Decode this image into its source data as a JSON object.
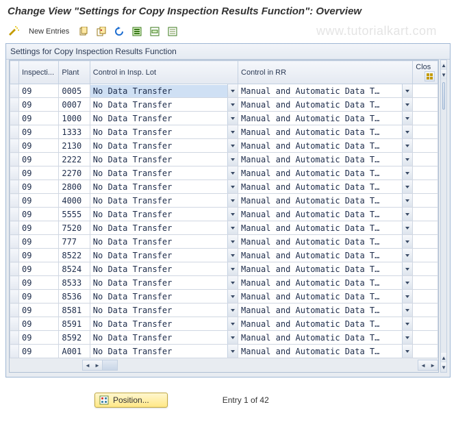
{
  "title": "Change View \"Settings for Copy Inspection Results Function\": Overview",
  "watermark": "www.tutorialkart.com",
  "toolbar": {
    "new_entries_label": "New Entries",
    "icons": {
      "wand": "wand-icon",
      "copy": "copy-icon",
      "copyall": "copy-all-icon",
      "undo": "undo-icon",
      "sel1": "select-all-icon",
      "sel2": "select-block-icon",
      "sel3": "deselect-all-icon"
    }
  },
  "panel": {
    "title": "Settings for Copy Inspection Results Function"
  },
  "columns": {
    "inspecti": "Inspecti...",
    "plant": "Plant",
    "cil": "Control in Insp. Lot",
    "crr": "Control in RR",
    "close": "Clos"
  },
  "rows": [
    {
      "insp": "09",
      "plant": "0005",
      "cil": "No Data Transfer",
      "crr": "Manual and Automatic Data T…",
      "close": ""
    },
    {
      "insp": "09",
      "plant": "0007",
      "cil": "No Data Transfer",
      "crr": "Manual and Automatic Data T…",
      "close": ""
    },
    {
      "insp": "09",
      "plant": "1000",
      "cil": "No Data Transfer",
      "crr": "Manual and Automatic Data T…",
      "close": ""
    },
    {
      "insp": "09",
      "plant": "1333",
      "cil": "No Data Transfer",
      "crr": "Manual and Automatic Data T…",
      "close": ""
    },
    {
      "insp": "09",
      "plant": "2130",
      "cil": "No Data Transfer",
      "crr": "Manual and Automatic Data T…",
      "close": ""
    },
    {
      "insp": "09",
      "plant": "2222",
      "cil": "No Data Transfer",
      "crr": "Manual and Automatic Data T…",
      "close": ""
    },
    {
      "insp": "09",
      "plant": "2270",
      "cil": "No Data Transfer",
      "crr": "Manual and Automatic Data T…",
      "close": ""
    },
    {
      "insp": "09",
      "plant": "2800",
      "cil": "No Data Transfer",
      "crr": "Manual and Automatic Data T…",
      "close": ""
    },
    {
      "insp": "09",
      "plant": "4000",
      "cil": "No Data Transfer",
      "crr": "Manual and Automatic Data T…",
      "close": ""
    },
    {
      "insp": "09",
      "plant": "5555",
      "cil": "No Data Transfer",
      "crr": "Manual and Automatic Data T…",
      "close": ""
    },
    {
      "insp": "09",
      "plant": "7520",
      "cil": "No Data Transfer",
      "crr": "Manual and Automatic Data T…",
      "close": ""
    },
    {
      "insp": "09",
      "plant": "777",
      "cil": "No Data Transfer",
      "crr": "Manual and Automatic Data T…",
      "close": ""
    },
    {
      "insp": "09",
      "plant": "8522",
      "cil": "No Data Transfer",
      "crr": "Manual and Automatic Data T…",
      "close": ""
    },
    {
      "insp": "09",
      "plant": "8524",
      "cil": "No Data Transfer",
      "crr": "Manual and Automatic Data T…",
      "close": ""
    },
    {
      "insp": "09",
      "plant": "8533",
      "cil": "No Data Transfer",
      "crr": "Manual and Automatic Data T…",
      "close": ""
    },
    {
      "insp": "09",
      "plant": "8536",
      "cil": "No Data Transfer",
      "crr": "Manual and Automatic Data T…",
      "close": ""
    },
    {
      "insp": "09",
      "plant": "8581",
      "cil": "No Data Transfer",
      "crr": "Manual and Automatic Data T…",
      "close": ""
    },
    {
      "insp": "09",
      "plant": "8591",
      "cil": "No Data Transfer",
      "crr": "Manual and Automatic Data T…",
      "close": ""
    },
    {
      "insp": "09",
      "plant": "8592",
      "cil": "No Data Transfer",
      "crr": "Manual and Automatic Data T…",
      "close": ""
    },
    {
      "insp": "09",
      "plant": "A001",
      "cil": "No Data Transfer",
      "crr": "Manual and Automatic Data T…",
      "close": ""
    }
  ],
  "footer": {
    "position_label": "Position...",
    "entry_label": "Entry 1 of 42"
  }
}
